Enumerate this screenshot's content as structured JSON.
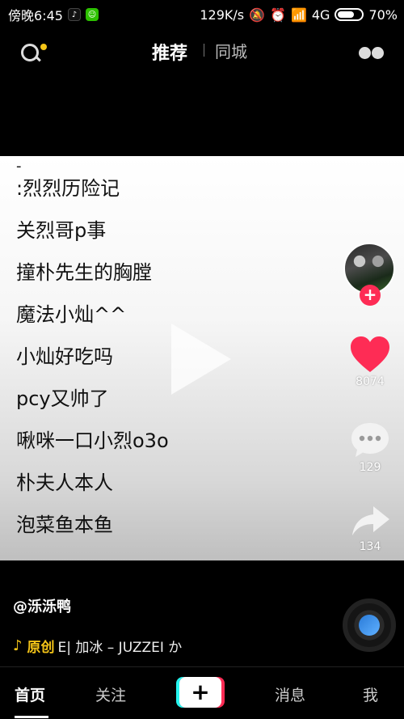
{
  "status_bar": {
    "time": "傍晚6:45",
    "speed": "129K/s",
    "network": "4G",
    "battery": "70%",
    "battery_fraction": 0.7
  },
  "top_nav": {
    "tab_recommend": "推荐",
    "tab_nearby": "同城"
  },
  "video": {
    "caption_dash": "-",
    "lines": [
      ":烈烈历险记",
      "关烈哥p事",
      "撞朴先生的胸膛",
      "魔法小灿^^",
      "小灿好吃吗",
      "pcy又帅了",
      "啾咪一口小烈o3o",
      "朴夫人本人",
      "泡菜鱼本鱼"
    ]
  },
  "actions": {
    "likes": "8074",
    "comments": "129",
    "shares": "134"
  },
  "info": {
    "author": "@泺泺鸭",
    "music_tag": "原创",
    "music_text": "E|   加冰 – JUZZEI   か"
  },
  "bottom_nav": {
    "home": "首页",
    "following": "关注",
    "add": "+",
    "messages": "消息",
    "me": "我"
  },
  "colors": {
    "accent_red": "#fe2c55",
    "accent_cyan": "#25f4ee",
    "music_gold": "#f5c518"
  }
}
